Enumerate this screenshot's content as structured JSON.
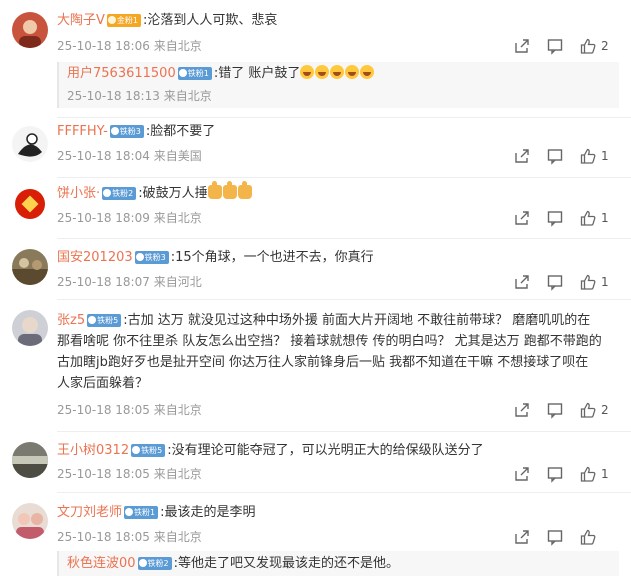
{
  "comments": [
    {
      "user": "大陶子V",
      "badge": "金粉1",
      "text": ":沦落到人人可欺、悲哀",
      "time": "25-10-18 18:06",
      "loc": "来自北京",
      "likes": "2",
      "reply": {
        "user": "用户7563611500",
        "badge": "铁粉1",
        "text": ":错了 账户鼓了",
        "time": "25-10-18 18:13",
        "loc": "来自北京"
      }
    },
    {
      "user": "FFFFHY-",
      "badge": "铁粉3",
      "text": ":脸都不要了",
      "time": "25-10-18 18:04",
      "loc": "来自美国",
      "likes": "1"
    },
    {
      "user": "饼小张·",
      "badge": "铁粉2",
      "text": ":破鼓万人捶",
      "time": "25-10-18 18:09",
      "loc": "来自北京",
      "likes": "1"
    },
    {
      "user": "国安201203",
      "badge": "铁粉3",
      "text": ":15个角球，一个也进不去，你真行",
      "time": "25-10-18 18:07",
      "loc": "来自河北",
      "likes": "1"
    },
    {
      "user": "张z5",
      "badge": "铁粉5",
      "text": ":古加 达万 就没见过这种中场外援 前面大片开阔地 不敢往前带球？ 磨磨叽叽的在",
      "text2": "那看啥呢 你不往里杀 队友怎么出空挡？ 接着球就想传 传的明白吗？ 尤其是达万 跑都不带跑的",
      "text3": "古加瞎jb跑好歹也是扯开空间 你达万往人家前锋身后一贴 我都不知道在干嘛 不想接球了呗在",
      "text4": "人家后面躲着？",
      "time": "25-10-18 18:05",
      "loc": "来自北京",
      "likes": "2"
    },
    {
      "user": "王小树0312",
      "badge": "铁粉5",
      "text": ":没有理论可能夺冠了，可以光明正大的给保级队送分了",
      "time": "25-10-18 18:05",
      "loc": "来自北京",
      "likes": "1"
    },
    {
      "user": "文刀刘老师",
      "badge": "铁粉1",
      "text": ":最该走的是李明",
      "time": "25-10-18 18:05",
      "loc": "来自北京",
      "likes": "",
      "reply": {
        "user": "秋色连波00",
        "badge": "铁粉2",
        "text": ":等他走了吧又发现最该走的还不是他。",
        "time": "",
        "loc": ""
      }
    }
  ],
  "colors": {
    "username": "#eb7350",
    "meta": "#999999",
    "badge_iron": "#5b9bd5",
    "badge_gold": "#f5a623"
  },
  "icons": {
    "share": "share-icon",
    "comment": "comment-icon",
    "like": "like-icon"
  }
}
